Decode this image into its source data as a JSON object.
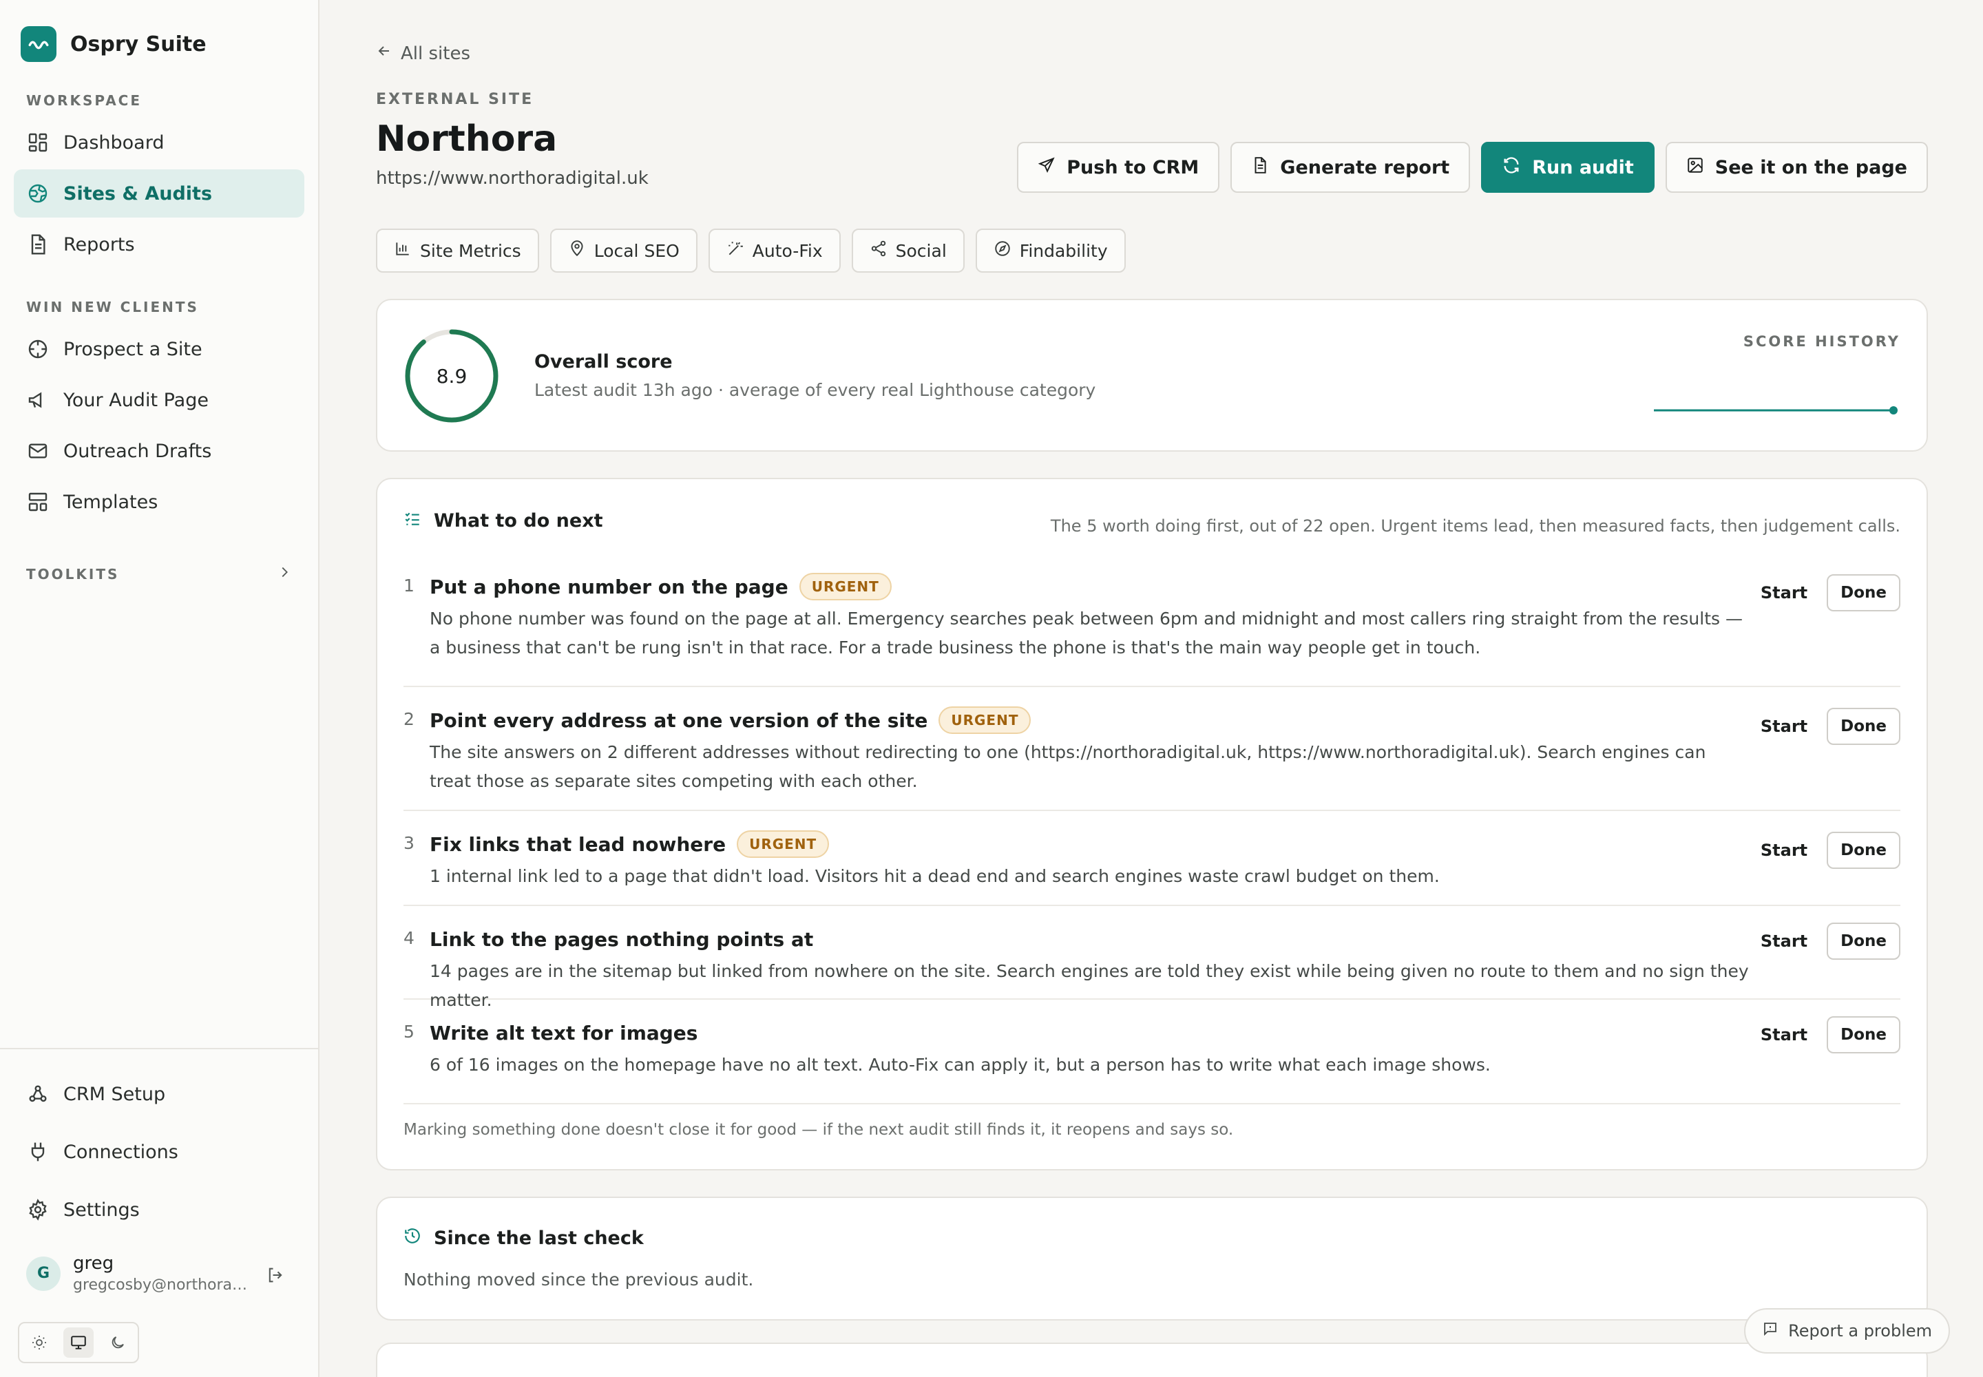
{
  "brand": {
    "name": "Ospry Suite"
  },
  "sidebar": {
    "workspace_label": "WORKSPACE",
    "workspace_items": [
      {
        "label": "Dashboard",
        "icon": "dashboard-icon"
      },
      {
        "label": "Sites & Audits",
        "icon": "globe-icon",
        "active": true
      },
      {
        "label": "Reports",
        "icon": "document-icon"
      }
    ],
    "clients_label": "WIN NEW CLIENTS",
    "clients_items": [
      {
        "label": "Prospect a Site",
        "icon": "crosshair-icon"
      },
      {
        "label": "Your Audit Page",
        "icon": "megaphone-icon"
      },
      {
        "label": "Outreach Drafts",
        "icon": "mail-icon"
      },
      {
        "label": "Templates",
        "icon": "templates-icon"
      }
    ],
    "toolkits_label": "TOOLKITS",
    "bottom_items": [
      {
        "label": "CRM Setup",
        "icon": "webhook-icon"
      },
      {
        "label": "Connections",
        "icon": "plug-icon"
      },
      {
        "label": "Settings",
        "icon": "gear-icon"
      }
    ],
    "user": {
      "initial": "G",
      "name": "greg",
      "email": "gregcosby@northoradigital.uk"
    }
  },
  "header": {
    "back_label": "All sites",
    "eyebrow": "EXTERNAL SITE",
    "title": "Northora",
    "url": "https://www.northoradigital.uk",
    "actions": {
      "push_crm": "Push to CRM",
      "generate_report": "Generate report",
      "run_audit": "Run audit",
      "see_page": "See it on the page"
    }
  },
  "tabs": [
    {
      "label": "Site Metrics",
      "icon": "bar-chart-icon"
    },
    {
      "label": "Local SEO",
      "icon": "map-pin-icon"
    },
    {
      "label": "Auto-Fix",
      "icon": "magic-wand-icon"
    },
    {
      "label": "Social",
      "icon": "share-icon"
    },
    {
      "label": "Findability",
      "icon": "compass-icon"
    }
  ],
  "score": {
    "value": "8.9",
    "max": 10,
    "title": "Overall score",
    "subtitle": "Latest audit 13h ago · average of every real Lighthouse category",
    "history_label": "SCORE HISTORY",
    "colors": {
      "ring": "#1f7a52",
      "track": "#e6e4df",
      "spark": "#12867b"
    }
  },
  "todo": {
    "title": "What to do next",
    "note": "The 5 worth doing first, out of 22 open. Urgent items lead, then measured facts, then judgement calls.",
    "start_label": "Start",
    "done_label": "Done",
    "urgent_label": "URGENT",
    "items": [
      {
        "num": "1",
        "title": "Put a phone number on the page",
        "urgent": true,
        "desc": "No phone number was found on the page at all. Emergency searches peak between 6pm and midnight and most callers ring straight from the results — a business that can't be rung isn't in that race. For a trade business the phone is that's the main way people get in touch."
      },
      {
        "num": "2",
        "title": "Point every address at one version of the site",
        "urgent": true,
        "desc": "The site answers on 2 different addresses without redirecting to one (https://northoradigital.uk, https://www.northoradigital.uk). Search engines can treat those as separate sites competing with each other."
      },
      {
        "num": "3",
        "title": "Fix links that lead nowhere",
        "urgent": true,
        "desc": "1 internal link led to a page that didn't load. Visitors hit a dead end and search engines waste crawl budget on them."
      },
      {
        "num": "4",
        "title": "Link to the pages nothing points at",
        "urgent": false,
        "desc": "14 pages are in the sitemap but linked from nowhere on the site. Search engines are told they exist while being given no route to them and no sign they matter."
      },
      {
        "num": "5",
        "title": "Write alt text for images",
        "urgent": false,
        "desc": "6 of 16 images on the homepage have no alt text. Auto-Fix can apply it, but a person has to write what each image shows."
      }
    ],
    "footer": "Marking something done doesn't close it for good — if the next audit still finds it, it reopens and says so."
  },
  "since": {
    "title": "Since the last check",
    "body": "Nothing moved since the previous audit."
  },
  "report_problem": "Report a problem",
  "theme": {
    "active": "system"
  }
}
